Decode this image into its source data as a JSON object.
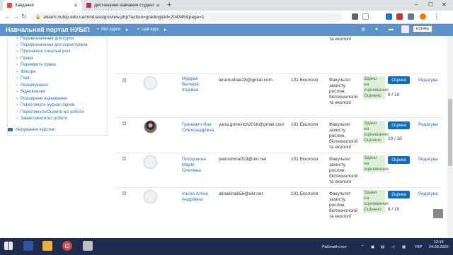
{
  "browser": {
    "tabs": [
      {
        "label": "Завдання",
        "active": true
      },
      {
        "label": "Дистанційне навчання студент",
        "active": false
      }
    ],
    "url": "elearn.nubip.edu.ua/mod/assign/view.php?action=grading&id=204345&page=1"
  },
  "navbar": {
    "brand": "Навчальний портал НУБіП",
    "my_courses": "Мої курси",
    "this_course": "Цей курс",
    "user_tooltip": "Ix264ity"
  },
  "admin_menu": {
    "items": [
      "Перевизначення для групи",
      "Перевизначення для користувача",
      "Призначені локальні ролі",
      "Права",
      "Перевірити права",
      "Фільтри",
      "Події",
      "Резервування",
      "Відновлення",
      "Розширене оцінювання",
      "Переглянути журнал оцінок",
      "Переглянути/Оцінити всі роботи",
      "Завантажити всі роботи"
    ],
    "footer": "Керування курсом"
  },
  "top_partial_faculty": "та екології",
  "rows": [
    {
      "name": [
        "Мудрак",
        "Валерія",
        "Ігорівна"
      ],
      "email": "leramudrak28@gmail.com",
      "group": "101 Екологія",
      "faculty": [
        "Факультет",
        "захисту",
        "рослин,",
        "біотехнологій",
        "та екології"
      ],
      "status": [
        "Здано",
        "на",
        "оцінювання",
        "Оцінено"
      ],
      "button": "Оцінка",
      "grade": "9 / 10",
      "edit": "Редагува"
    },
    {
      "name": [
        "Гриневич Яна",
        "Олександрівна"
      ],
      "email": "yana.grinevich2016@gmail.com",
      "group": "101 Екологія",
      "faculty": [
        "Факультет",
        "захисту",
        "рослин,",
        "біотехнологій",
        "та екології"
      ],
      "status": [
        "Здано",
        "на",
        "оцінювання",
        "Оцінено"
      ],
      "button": "Оцінка",
      "grade": "10 / 10",
      "edit": "Редагува"
    },
    {
      "name": [
        "Петрушина",
        "Марія",
        "Олегівна"
      ],
      "email": "petrushina019@ukr.net",
      "group": "101 Екологія",
      "faculty": [
        "Факультет",
        "захисту",
        "рослин,",
        "біотехнологій",
        "та екології"
      ],
      "status": [
        "Здано",
        "на",
        "оцінювання"
      ],
      "button": "Оцінка",
      "grade": "-",
      "edit": "Редагува"
    },
    {
      "name": [
        "Ільїна Аліна",
        "Андріївна"
      ],
      "email": "alinailina656@ukr.net",
      "group": "101 Екологія",
      "faculty": [
        "Факультет",
        "захисту",
        "рослин,",
        "біотехнологій",
        "та екології"
      ],
      "status": [
        "Здано",
        "на",
        "оцінювання",
        "Оцінено"
      ],
      "button": "Оцінка",
      "grade": "8 / 10",
      "edit": "Редагува"
    }
  ],
  "taskbar": {
    "desktop": "Рабочий стол",
    "lang": "УКР",
    "time": "12:16",
    "date": "24.03.2020"
  },
  "colors": {
    "navbar": "#5b92c9",
    "link": "#2a6ebb",
    "button": "#0f6cbf",
    "status_bg": "#dff0d8",
    "taskbar": "#1f2c4d"
  }
}
